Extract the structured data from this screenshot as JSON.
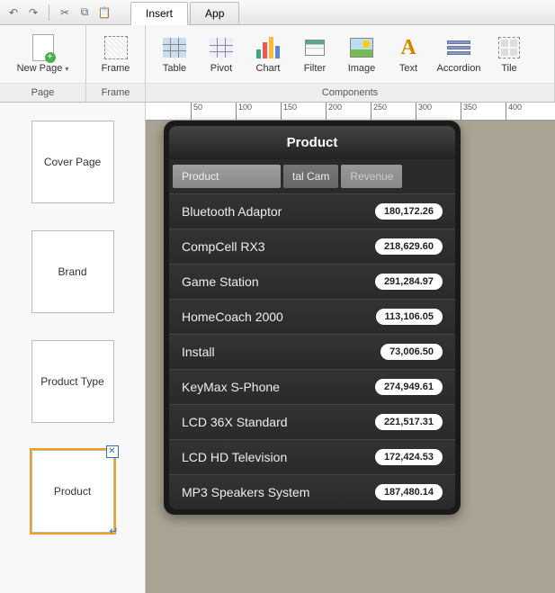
{
  "quick_access": {
    "undo": "↶",
    "redo": "↷",
    "cut": "✂",
    "copy": "⧉",
    "paste": "📋"
  },
  "tabs": {
    "insert": "Insert",
    "app": "App"
  },
  "ribbon": {
    "page_group": "Page",
    "frame_group": "Frame",
    "components_group": "Components",
    "new_page": "New Page",
    "frame": "Frame",
    "table": "Table",
    "pivot": "Pivot",
    "chart": "Chart",
    "filter": "Filter",
    "image": "Image",
    "text": "Text",
    "accordion": "Accordion",
    "tile": "Tile"
  },
  "ruler_ticks": [
    "50",
    "100",
    "150",
    "200",
    "250",
    "300",
    "350",
    "400"
  ],
  "pages": {
    "items": [
      {
        "label": "Cover Page"
      },
      {
        "label": "Brand"
      },
      {
        "label": "Product Type"
      },
      {
        "label": "Product"
      }
    ]
  },
  "widget": {
    "title": "Product",
    "filters": {
      "product": "Product",
      "mid": "tal Cam",
      "revenue": "Revenue"
    },
    "rows": [
      {
        "name": "Bluetooth Adaptor",
        "value": "180,172.26"
      },
      {
        "name": "CompCell RX3",
        "value": "218,629.60"
      },
      {
        "name": "Game Station",
        "value": "291,284.97"
      },
      {
        "name": "HomeCoach 2000",
        "value": "113,106.05"
      },
      {
        "name": "Install",
        "value": "73,006.50"
      },
      {
        "name": "KeyMax S-Phone",
        "value": "274,949.61"
      },
      {
        "name": "LCD 36X Standard",
        "value": "221,517.31"
      },
      {
        "name": "LCD HD Television",
        "value": "172,424.53"
      },
      {
        "name": "MP3 Speakers System",
        "value": "187,480.14"
      }
    ]
  }
}
